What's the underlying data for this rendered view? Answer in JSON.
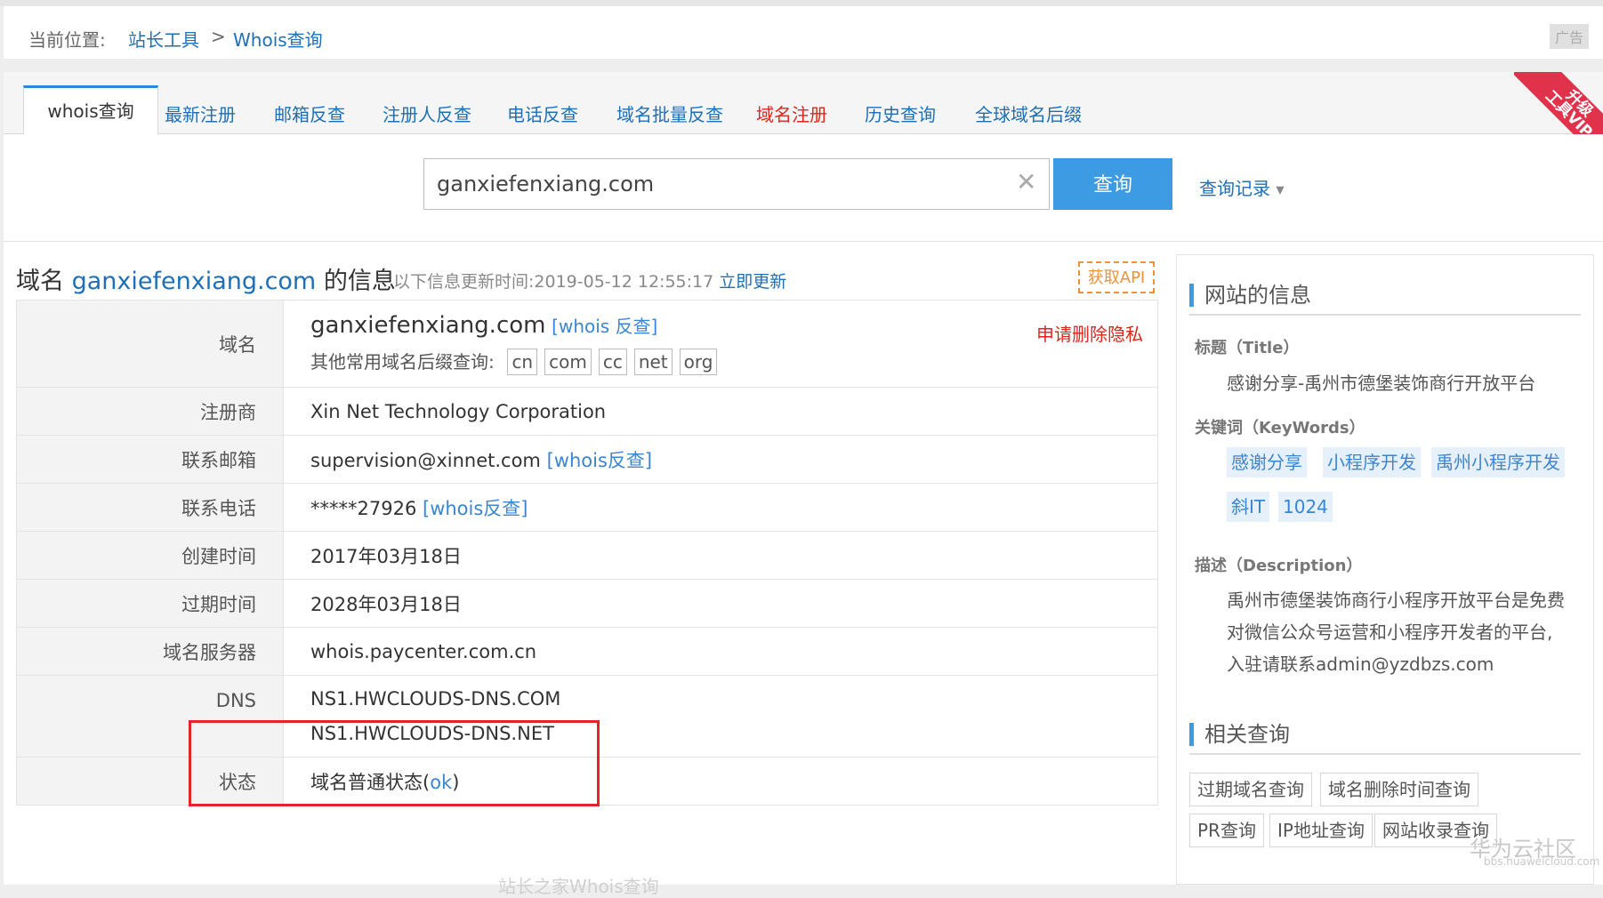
{
  "breadcrumb": {
    "label": "当前位置:",
    "link1": "站长工具",
    "sep": ">",
    "link2": "Whois查询"
  },
  "ad": "广告",
  "tabs": [
    "whois查询",
    "最新注册",
    "邮箱反查",
    "注册人反查",
    "电话反查",
    "域名批量反查",
    "域名注册",
    "历史查询",
    "全球域名后缀"
  ],
  "vip": {
    "line1": "升级",
    "line2": "工具VIP"
  },
  "search": {
    "value": "ganxiefenxiang.com",
    "button": "查询",
    "history": "查询记录"
  },
  "info": {
    "prefix": "域名",
    "domain": "ganxiefenxiang.com",
    "suffix": "的信息",
    "updated_label": "以下信息更新时间:",
    "updated_time": "2019-05-12 12:55:17",
    "update_link": "立即更新",
    "api": "获取API"
  },
  "rows": {
    "domain": {
      "key": "域名",
      "value": "ganxiefenxiang.com",
      "reverse": "[whois 反查]",
      "suffix_label": "其他常用域名后缀查询:",
      "suffixes": [
        "cn",
        "com",
        "cc",
        "net",
        "org"
      ],
      "delete": "申请删除隐私"
    },
    "registrar": {
      "key": "注册商",
      "value": "Xin Net Technology Corporation"
    },
    "email": {
      "key": "联系邮箱",
      "value": "supervision@xinnet.com",
      "reverse": "[whois反查]"
    },
    "phone": {
      "key": "联系电话",
      "value": "*****27926",
      "reverse": "[whois反查]"
    },
    "created": {
      "key": "创建时间",
      "value": "2017年03月18日"
    },
    "expires": {
      "key": "过期时间",
      "value": "2028年03月18日"
    },
    "server": {
      "key": "域名服务器",
      "value": "whois.paycenter.com.cn"
    },
    "dns": {
      "key": "DNS",
      "ns1": "NS1.HWCLOUDS-DNS.COM",
      "ns2": "NS1.HWCLOUDS-DNS.NET"
    },
    "status": {
      "key": "状态",
      "value": "域名普通状态(",
      "ok": "ok",
      ")": ")"
    }
  },
  "footer_faint": "站长之家Whois查询",
  "sidebar": {
    "site_info": "网站的信息",
    "title_label": "标题（Title）",
    "title_value": "感谢分享-禹州市德堡装饰商行开放平台",
    "keywords_label": "关键词（KeyWords）",
    "keywords": [
      "感谢分享",
      "小程序开发",
      "禹州小程序开发",
      "斜IT",
      "1024"
    ],
    "desc_label": "描述（Description）",
    "desc_lines": [
      "禹州市德堡装饰商行小程序开放平台是免费",
      "对微信公众号运营和小程序开发者的平台,",
      "入驻请联系admin@yzdbzs.com"
    ],
    "related": "相关查询",
    "related_items": [
      "过期域名查询",
      "域名删除时间查询",
      "PR查询",
      "IP地址查询",
      "网站收录查询"
    ]
  },
  "watermark": {
    "main": "华为云社区",
    "sub": "bbs.huaweicloud.com"
  }
}
